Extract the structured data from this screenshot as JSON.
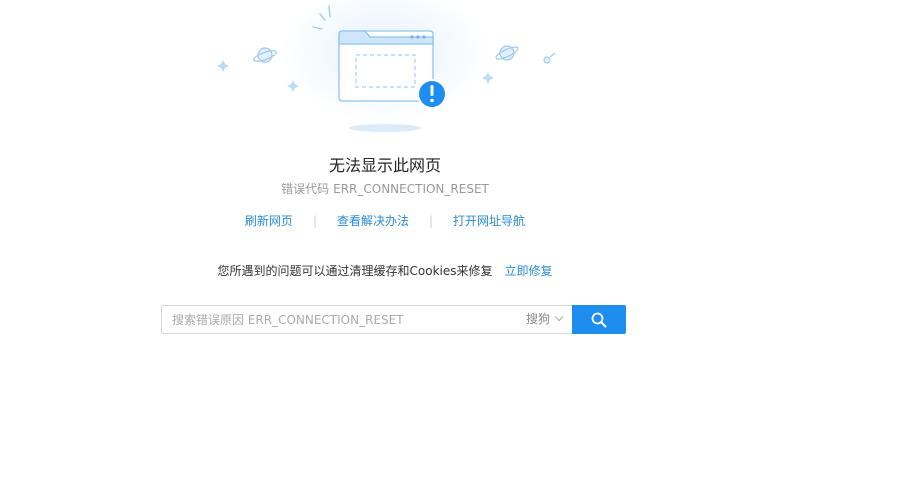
{
  "error": {
    "title": "无法显示此网页",
    "code_label": "错误代码",
    "code": "ERR_CONNECTION_RESET"
  },
  "actions": [
    {
      "label": "刷新网页"
    },
    {
      "label": "查看解决办法"
    },
    {
      "label": "打开网址导航"
    }
  ],
  "separator": "|",
  "hint": {
    "text": "您所遇到的问题可以通过清理缓存和Cookies来修复",
    "fix_label": "立即修复"
  },
  "search": {
    "placeholder": "搜索错误原因 ERR_CONNECTION_RESET",
    "engine": "搜狗"
  },
  "colors": {
    "accent": "#1e8df0",
    "link": "#2b8bd6",
    "alert": "#1e8df0"
  },
  "icons": {
    "illustration": "browser-window-error-illustration",
    "alert": "exclamation-circle-icon",
    "search": "search-icon"
  }
}
